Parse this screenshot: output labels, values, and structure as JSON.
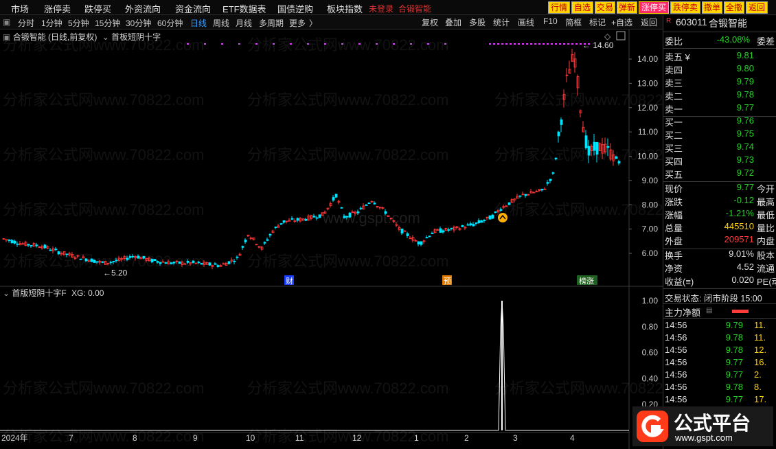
{
  "menu": {
    "items": [
      "市场",
      "涨停卖",
      "跌停买",
      "外资流向",
      "资金流向",
      "ETF数据表",
      "国债逆购",
      "板块指数"
    ],
    "login": "未登录",
    "stock_red": "合锻智能",
    "quick_buttons": [
      "行情",
      "自选",
      "交易",
      "弹新",
      "涨停买",
      "跌停卖",
      "撤单",
      "全撤",
      "返回"
    ]
  },
  "toolbar": {
    "periods": [
      "分时",
      "1分钟",
      "5分钟",
      "15分钟",
      "30分钟",
      "60分钟",
      "日线",
      "周线",
      "月线",
      "多周期",
      "更多"
    ],
    "active_period": "日线",
    "right_items": [
      "复权",
      "叠加",
      "多股",
      "统计",
      "画线",
      "F10",
      "简框",
      "标记",
      "+自选",
      "返回"
    ]
  },
  "chart_title": "合锻智能 (日线,前复权)",
  "indicator_name": "首板短阴十字",
  "sub_indicator": "首版短阴十字F",
  "sub_value_label": "XG: 0.00",
  "marks": {
    "high": "14.60",
    "low": "5.20",
    "cai": "财",
    "yu": "预",
    "bang": "榜涨"
  },
  "price_axis": [
    "14.00",
    "13.00",
    "12.00",
    "11.00",
    "10.00",
    "9.00",
    "8.00",
    "7.00",
    "6.00"
  ],
  "sub_axis": [
    "1.00",
    "0.80",
    "0.60",
    "0.40",
    "0.20"
  ],
  "date_axis": [
    "2024年",
    "7",
    "8",
    "9",
    "10",
    "11",
    "12",
    "1",
    "2",
    "3",
    "4"
  ],
  "watermark": "分析家公式网www.70822.com",
  "watermark2": "www.gspt.com",
  "quote": {
    "code": "603011",
    "name": "合锻智能",
    "weibi_label": "委比",
    "weibi_value": "-43.08%",
    "weicha_label": "委差",
    "asks": [
      {
        "label": "卖五 ¥",
        "price": "9.81"
      },
      {
        "label": "卖四",
        "price": "9.80"
      },
      {
        "label": "卖三",
        "price": "9.79"
      },
      {
        "label": "卖二",
        "price": "9.78"
      },
      {
        "label": "卖一",
        "price": "9.77"
      }
    ],
    "bids": [
      {
        "label": "买一",
        "price": "9.76"
      },
      {
        "label": "买二",
        "price": "9.75"
      },
      {
        "label": "买三",
        "price": "9.74"
      },
      {
        "label": "买四",
        "price": "9.73"
      },
      {
        "label": "买五",
        "price": "9.72"
      }
    ],
    "stats": [
      {
        "label": "现价",
        "value": "9.77",
        "tail": "今开",
        "color": "g"
      },
      {
        "label": "涨跌",
        "value": "-0.12",
        "tail": "最高",
        "color": "g"
      },
      {
        "label": "涨幅",
        "value": "-1.21%",
        "tail": "最低",
        "color": "g"
      },
      {
        "label": "总量",
        "value": "445510",
        "tail": "量比",
        "color": "y"
      },
      {
        "label": "外盘",
        "value": "209571",
        "tail": "内盘",
        "color": "r"
      }
    ],
    "stats2": [
      {
        "label": "换手",
        "value": "9.01%",
        "tail": "股本",
        "color": "w"
      },
      {
        "label": "净资",
        "value": "4.52",
        "tail": "流通",
        "color": "w"
      },
      {
        "label": "收益(≡)",
        "value": "0.020",
        "tail": "PE(动)",
        "color": "w"
      }
    ],
    "trade_state": "交易状态: 闭市阶段 15:00",
    "main_flow_label": "主力净额",
    "ticks": [
      {
        "time": "14:56",
        "price": "9.79",
        "vol": "11."
      },
      {
        "time": "14:56",
        "price": "9.78",
        "vol": "11."
      },
      {
        "time": "14:56",
        "price": "9.78",
        "vol": "12."
      },
      {
        "time": "14:56",
        "price": "9.77",
        "vol": "16."
      },
      {
        "time": "14:56",
        "price": "9.77",
        "vol": "2."
      },
      {
        "time": "14:56",
        "price": "9.78",
        "vol": "8."
      },
      {
        "time": "14:56",
        "price": "9.77",
        "vol": "17."
      }
    ]
  },
  "brand": {
    "name": "公式平台",
    "url": "www.gspt.com"
  },
  "colors": {
    "up": "#ff3b3b",
    "down": "#00e5ff",
    "panel_bg": "#000000",
    "accent": "#3aa0ff"
  }
}
